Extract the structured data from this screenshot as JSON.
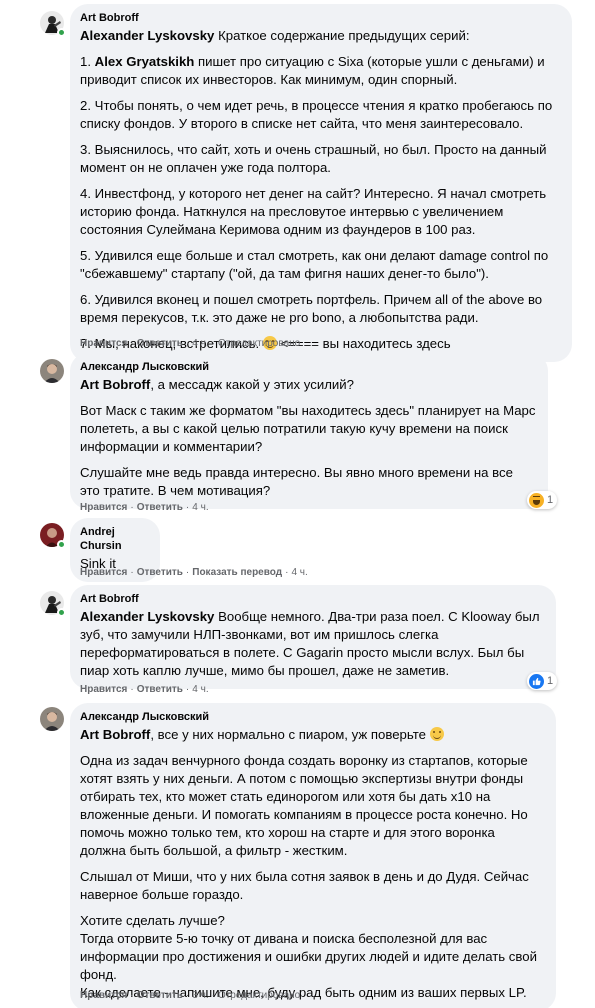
{
  "comments": [
    {
      "author": "Art Bobroff",
      "paragraphs": [
        {
          "mention": "Alexander Lyskovsky",
          "text": " Краткое содержание предыдущих серий:"
        },
        {
          "mention": "",
          "text": "1. "
        },
        {
          "mention": "",
          "text": "2. Чтобы понять, о чем идет речь, в процессе чтения я кратко пробегаюсь по списку фондов. У второго в списке нет сайта, что меня заинтересовало."
        },
        {
          "mention": "",
          "text": "3. Выяснилось, что сайт, хоть и очень страшный, но был. Просто на данный момент он не оплачен уже года полтора."
        },
        {
          "mention": "",
          "text": "4. Инвестфонд, у которого нет денег на сайт? Интересно. Я начал смотреть историю фонда. Наткнулся на пресловутое интервью с увеличением состояния Сулеймана Керимова одним из фаундеров в 100 раз."
        },
        {
          "mention": "",
          "text": "5. Удивился еще больше и стал смотреть, как они делают damage control по \"сбежавшему\" стартапу (\"ой, да там фигня наших денег-то было\")."
        },
        {
          "mention": "",
          "text": "6. Удивился вконец и пошел смотреть портфель. Причем all of the above во время перекусов, т.к. это даже не pro bono, а любопытства ради."
        },
        {
          "mention": "",
          "text": "7. Мы, наконец, встретились."
        }
      ],
      "item1_mention": "Alex Gryatskikh",
      "item1_text": " пишет про ситуацию с Sixa (которые ушли с деньгами) и приводит список их инвесторов. Как минимум, один спорный.",
      "item7_after_emoji": " <==== вы находитесь здесь",
      "like": "Нравится",
      "reply": "Ответить",
      "time": "4 ч.",
      "edited": "Отредактировано"
    },
    {
      "author": "Александр Лысковский",
      "mention": "Art Bobroff",
      "first_text": ", а мессадж какой у этих усилий?",
      "paragraphs": [
        "Вот Маск с таким же форматом \"вы находитесь здесь\" планирует на Марс полететь, а вы с какой целью потратили такую кучу времени на поиск информации и комментарии?",
        "Слушайте мне ведь правда интересно. Вы явно много времени на все это тратите. В чем мотивация?"
      ],
      "like": "Нравится",
      "reply": "Ответить",
      "time": "4 ч.",
      "reaction_count": "1"
    },
    {
      "author": "Andrej Chursin",
      "text": "Sink it",
      "like": "Нравится",
      "reply": "Ответить",
      "translate": "Показать перевод",
      "time": "4 ч."
    },
    {
      "author": "Art Bobroff",
      "mention": "Alexander Lyskovsky",
      "text": " Вообще немного. Два-три раза поел. С Klooway был зуб, что замучили НЛП-звонками, вот им пришлось слегка переформатироваться в полете. С Gagarin просто мысли вслух. Был бы пиар хоть каплю лучше, мимо бы прошел, даже не заметив.",
      "like": "Нравится",
      "reply": "Ответить",
      "time": "4 ч.",
      "reaction_count": "1"
    },
    {
      "author": "Александр Лысковский",
      "mention": "Art Bobroff",
      "first_text": ", все у них нормально с пиаром, уж поверьте",
      "paragraphs": [
        "Одна из задач венчурного фонда создать воронку из стартапов, которые хотят взять у них деньги. А потом с помощью экспертизы внутри фонды отбирать тех, кто может стать единорогом или хотя бы дать x10 на вложенные деньги. И помогать компаниям в процессе роста конечно. Но помочь можно только тем, кто хорош на старте и для этого воронка должна быть большой, а фильтр - жестким.",
        "Слышал от Миши, что у них была сотня заявок в день и до Дудя. Сейчас наверное больше гораздо.",
        "Хотите сделать лучше?\nТогда оторвите 5-ю точку от дивана и поиска бесполезной для вас информации про достижения и ошибки других людей и идите делать свой фонд.\nКак сделаете - напишите мне, буду рад быть одним из ваших первых LP."
      ],
      "like": "Нравится",
      "reply": "Ответить",
      "time": "3 ч.",
      "edited": "Отредактировано"
    }
  ],
  "colors": {
    "bubble": "#f0f2f5",
    "meta": "#65676b",
    "online": "#31a24c",
    "like_blue": "#1877f2"
  },
  "icons": [
    "avatar-art-bobroff",
    "avatar-alexander",
    "avatar-andrej",
    "haha-reaction-icon",
    "like-reaction-icon",
    "smile-emoji-icon",
    "online-dot"
  ]
}
